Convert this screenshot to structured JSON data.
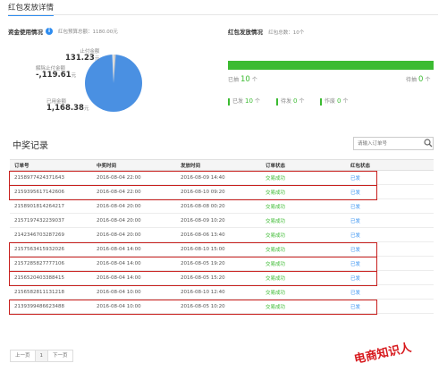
{
  "header": {
    "title": "红包发放详情"
  },
  "fund": {
    "heading": "资金使用情况",
    "total_label": "红包预算总额：1180.00元",
    "pie_colors": {
      "used": "#4a90e2",
      "unpaid": "#cfcfcf"
    },
    "paid": {
      "label": "止付金额",
      "value": "131.23",
      "unit": "元"
    },
    "unfrozen": {
      "label": "解除止付金额",
      "value": "-,119.61",
      "unit": "元"
    },
    "used": {
      "label": "已用金额",
      "value": "1,168.38",
      "unit": "元"
    }
  },
  "redpacket": {
    "heading": "红包发放情况",
    "total_count": "红包总数：10个",
    "progress_fraction": 1.0,
    "issued": {
      "label": "已抽",
      "value": "10",
      "unit": "个"
    },
    "pending": {
      "label": "待抽",
      "value": "0",
      "unit": "个"
    },
    "sent": {
      "label": "已发",
      "value": "10",
      "unit": "个"
    },
    "to_send": {
      "label": "待发",
      "value": "0",
      "unit": "个"
    },
    "invalid": {
      "label": "作废",
      "value": "0",
      "unit": "个"
    }
  },
  "records": {
    "title": "中奖记录",
    "search_placeholder": "请输入订单号",
    "columns": [
      "订单号",
      "中奖时间",
      "发放时间",
      "订单状态",
      "红包状态"
    ],
    "rows": [
      {
        "order": "2158977424371643",
        "win": "2016-08-04 22:00",
        "issue": "2016-08-09 14:40",
        "status": "交易成功",
        "rp": "已发",
        "highlight": true
      },
      {
        "order": "2159395617142606",
        "win": "2016-08-04 22:00",
        "issue": "2016-08-10 09:20",
        "status": "交易成功",
        "rp": "已发",
        "highlight": true
      },
      {
        "order": "2158901814264217",
        "win": "2016-08-04 20:00",
        "issue": "2016-08-08 00:20",
        "status": "交易成功",
        "rp": "已发",
        "highlight": false
      },
      {
        "order": "2157197432239037",
        "win": "2016-08-04 20:00",
        "issue": "2016-08-09 10:20",
        "status": "交易成功",
        "rp": "已发",
        "highlight": false
      },
      {
        "order": "2142346703287269",
        "win": "2016-08-04 20:00",
        "issue": "2016-08-06 13:40",
        "status": "交易成功",
        "rp": "已发",
        "highlight": false
      },
      {
        "order": "2157563415932026",
        "win": "2016-08-04 14:00",
        "issue": "2016-08-10 15:00",
        "status": "交易成功",
        "rp": "已发",
        "highlight": true
      },
      {
        "order": "2157285827777106",
        "win": "2016-08-04 14:00",
        "issue": "2016-08-05 19:20",
        "status": "交易成功",
        "rp": "已发",
        "highlight": true
      },
      {
        "order": "2156520403388415",
        "win": "2016-08-04 14:00",
        "issue": "2016-08-05 15:20",
        "status": "交易成功",
        "rp": "已发",
        "highlight": true
      },
      {
        "order": "2156582811131218",
        "win": "2016-08-04 10:00",
        "issue": "2016-08-10 12:40",
        "status": "交易成功",
        "rp": "已发",
        "highlight": false
      },
      {
        "order": "2139399486623488",
        "win": "2016-08-04 10:00",
        "issue": "2016-08-05 10:20",
        "status": "交易成功",
        "rp": "已发",
        "highlight": true
      }
    ]
  },
  "pagination": {
    "prev": "上一页",
    "current": "1",
    "next": "下一页"
  },
  "watermark": "电商知识人",
  "colors": {
    "accent": "#2d8cf0",
    "success": "#3cbb32",
    "highlight_border": "#c8201e",
    "watermark": "#d7191d"
  }
}
